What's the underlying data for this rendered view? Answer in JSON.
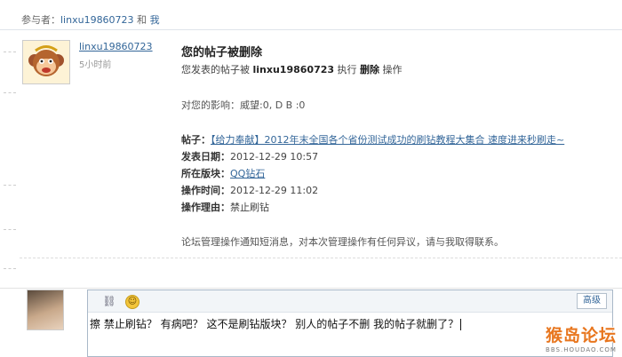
{
  "participants": {
    "label": "参与者：",
    "user": "linxu19860723",
    "joiner": " 和 ",
    "me": "我"
  },
  "message": {
    "sender": "linxu19860723",
    "time": "5小时前",
    "title": "您的帖子被删除",
    "body_prefix": "您发表的帖子被 ",
    "actor": "linxu19860723",
    "body_mid": " 执行 ",
    "action": "删除",
    "body_suffix": " 操作",
    "impact": "对您的影响：威望:0, D B :0",
    "post_label": "帖子：",
    "post_title": "【给力奉献】2012年末全国各个省份测试成功的刷钻教程大集合  速度进来秒刷走~",
    "published_label": "发表日期：",
    "published_value": "2012-12-29 10:57",
    "board_label": "所在版块：",
    "board_value": "QQ钻石",
    "op_time_label": "操作时间：",
    "op_time_value": "2012-12-29 11:02",
    "reason_label": "操作理由：",
    "reason_value": "禁止刷钻",
    "footer": "论坛管理操作通知短消息，对本次管理操作有任何异议，请与我取得联系。"
  },
  "reply": {
    "advanced_label": "高级",
    "text": "擦  禁止刷钻？  有病吧？  这不是刷钻版块？  别人的帖子不删  我的帖子就删了？",
    "link_icon": "link-icon",
    "smiley_icon": "smiley-icon"
  },
  "watermark": {
    "main": "猴岛论坛",
    "sub": "BBS.HOUDAO.COM"
  }
}
